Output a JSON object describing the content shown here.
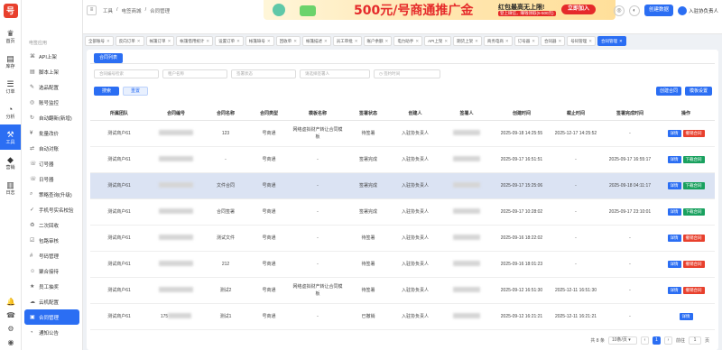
{
  "topbar": {
    "crumbs": [
      "工具",
      "电签商城",
      "合同管理"
    ]
  },
  "banner": {
    "headline": "500元/号商通推广金",
    "promo": "红包最高无上限!",
    "sub": "登上微信，赚钱领取(5-500元)",
    "cta": "立即加入"
  },
  "header_actions": {
    "create_label": "创建数据",
    "user_label": "入驻协负责人"
  },
  "rail": [
    {
      "icon": "♛",
      "label": "首页"
    },
    {
      "icon": "▤",
      "label": "库存"
    },
    {
      "icon": "☰",
      "label": "订单"
    },
    {
      "icon": "◔",
      "label": "分析"
    },
    {
      "icon": "⚒",
      "label": "工具"
    },
    {
      "icon": "◆",
      "label": "营销"
    },
    {
      "icon": "▥",
      "label": "日志"
    }
  ],
  "sidebar": {
    "section": "电签应用",
    "items": [
      "API上架",
      "脚本上架",
      "选品配置",
      "账号监控",
      "自动翻新(新增)",
      "批量改价",
      "自动对账",
      "订号器",
      "日号器",
      "策略查询(升级)",
      "手机号实名校验",
      "二次回收",
      "包路审核",
      "号码管理",
      "聚合接待",
      "员工抽奖",
      "云机配置",
      "合同管理",
      "通知公告"
    ],
    "active_index": 17
  },
  "tabs": [
    "全部账号",
    "反向订单",
    "帐篷订单",
    "帐篷借用统计",
    "设置订单",
    "帐篷缺号",
    "回收单",
    "帐篷描述",
    "员工审批",
    "账户余额",
    "电力助手",
    "API上架",
    "期货上架",
    "商务电商",
    "订号器",
    "合同器",
    "号码管理",
    "合同管理"
  ],
  "active_tab": 17,
  "panel": {
    "subtab": "合同列表",
    "filters": {
      "contract_no": "合同编号检索",
      "tenant": "租户名称",
      "status": "签署状态",
      "signer": "请选择签署人",
      "date": "签约时间"
    },
    "search_label": "搜索",
    "reset_label": "重置",
    "create_label": "创建合同",
    "template_label": "模板设置"
  },
  "table": {
    "headers": [
      "所属团队",
      "合同编号",
      "合同名称",
      "合同类型",
      "模板名称",
      "签署状态",
      "创建人",
      "签署人",
      "创建时间",
      "截止时间",
      "签署完成时间",
      "操作"
    ],
    "rows": [
      {
        "team": "测试商户61",
        "name": "123",
        "type": "号商通",
        "template": "网络虚拟财产转让合同模板",
        "status": "待签署",
        "creator": "入驻协负责人",
        "created": "2025-09-18 14:25:55",
        "deadline": "2025-12-17 14:25:52",
        "done": "-",
        "actions": [
          "详情",
          "撤销合同"
        ]
      },
      {
        "team": "测试商户61",
        "name": "-",
        "type": "号商通",
        "template": "-",
        "status": "签署完成",
        "creator": "入驻协负责人",
        "created": "2025-09-17 16:51:51",
        "deadline": "-",
        "done": "2025-09-17 16:55:17",
        "actions": [
          "详情",
          "下载合同"
        ]
      },
      {
        "team": "测试商户61",
        "name": "文件合同",
        "type": "号商通",
        "template": "-",
        "status": "签署完成",
        "creator": "入驻协负责人",
        "created": "2025-09-17 15:25:06",
        "deadline": "-",
        "done": "2025-09-18 04:11:17",
        "actions": [
          "详情",
          "下载合同"
        ]
      },
      {
        "team": "测试商户61",
        "name": "合同签署",
        "type": "号商通",
        "template": "-",
        "status": "签署完成",
        "creator": "入驻协负责人",
        "created": "2025-09-17 10:28:02",
        "deadline": "-",
        "done": "2025-09-17 23:10:01",
        "actions": [
          "详情",
          "下载合同"
        ]
      },
      {
        "team": "测试商户61",
        "name": "测试文件",
        "type": "号商通",
        "template": "-",
        "status": "待签署",
        "creator": "入驻协负责人",
        "created": "2025-09-16 18:22:02",
        "deadline": "-",
        "done": "-",
        "actions": [
          "详情",
          "撤销合同"
        ]
      },
      {
        "team": "测试商户61",
        "name": "212",
        "type": "号商通",
        "template": "-",
        "status": "待签署",
        "creator": "入驻协负责人",
        "created": "2025-09-16 18:01:23",
        "deadline": "-",
        "done": "-",
        "actions": [
          "详情",
          "撤销合同"
        ]
      },
      {
        "team": "测试商户61",
        "name": "测试2",
        "type": "号商通",
        "template": "网络虚拟财产转让合同模板",
        "status": "待签署",
        "creator": "入驻协负责人",
        "created": "2025-09-12 16:51:30",
        "deadline": "2025-12-11 16:51:30",
        "done": "-",
        "actions": [
          "详情",
          "撤销合同"
        ]
      },
      {
        "team": "测试商户61",
        "no_prefix": "175",
        "name": "测试1",
        "type": "号商通",
        "template": "-",
        "status": "已撤销",
        "creator": "入驻协负责人",
        "created": "2025-09-12 16:21:21",
        "deadline": "2025-12-11 16:21:21",
        "done": "-",
        "actions": [
          "详情"
        ]
      }
    ]
  },
  "pager": {
    "total": "共 8 条",
    "per_page": "10条/页",
    "page": "1",
    "goto": "前往",
    "goto_value": "1",
    "page_unit": "页"
  },
  "colors": {
    "primary": "#2b6ef3",
    "danger": "#e8402d",
    "success": "#19a15f"
  }
}
